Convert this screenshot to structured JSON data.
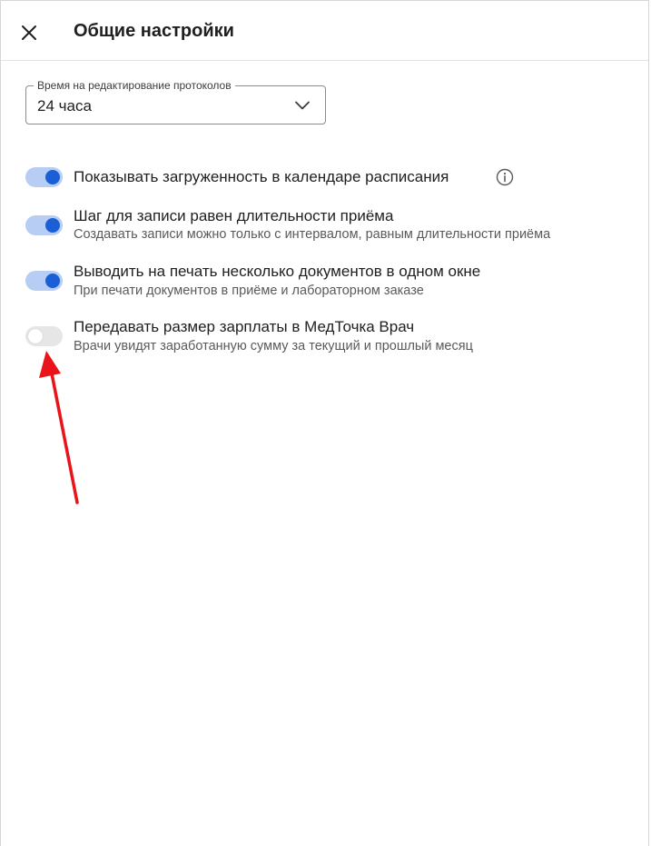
{
  "header": {
    "title": "Общие настройки",
    "close_icon": "close-icon"
  },
  "protocol_edit_time": {
    "label": "Время на редактирование протоколов",
    "value": "24 часа",
    "dropdown_icon": "chevron-down-icon"
  },
  "settings": [
    {
      "title": "Показывать загруженность в календаре расписания",
      "subtitle": "",
      "enabled": true,
      "info_icon": "info-icon"
    },
    {
      "title": "Шаг для записи равен длительности приёма",
      "subtitle": "Создавать записи можно только с интервалом, равным длительности приёма",
      "enabled": true
    },
    {
      "title": "Выводить на печать несколько документов в одном окне",
      "subtitle": "При печати документов в приёме и лабораторном заказе",
      "enabled": true
    },
    {
      "title": "Передавать размер зарплаты в МедТочка Врач",
      "subtitle": "Врачи увидят заработанную сумму за текущий и прошлый месяц",
      "enabled": false
    }
  ],
  "annotation": {
    "arrow_color": "#e8141a",
    "arrow_icon": "red-arrow-annotation"
  },
  "colors": {
    "toggle_on_track": "#b8cdf3",
    "toggle_on_knob": "#1a5fd6",
    "toggle_off_track": "#e6e6e6"
  }
}
